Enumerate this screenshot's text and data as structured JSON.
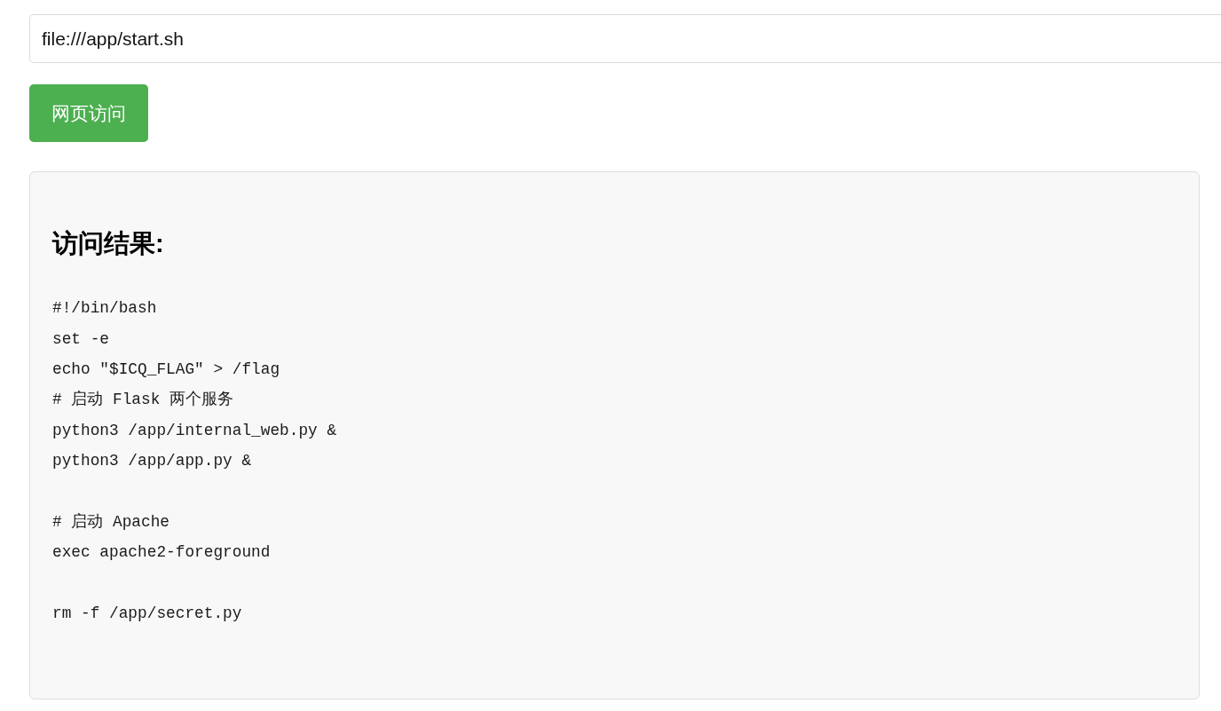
{
  "url_field": {
    "value": "file:///app/start.sh"
  },
  "submit_button": {
    "label": "网页访问"
  },
  "result": {
    "heading": "访问结果:",
    "output_blocks": [
      [
        "#!/bin/bash",
        "set -e",
        "echo \"$ICQ_FLAG\" > /flag",
        "# 启动 Flask 两个服务",
        "python3 /app/internal_web.py &",
        "python3 /app/app.py &"
      ],
      [
        "# 启动 Apache",
        "exec apache2-foreground"
      ],
      [
        "rm -f /app/secret.py"
      ]
    ]
  }
}
